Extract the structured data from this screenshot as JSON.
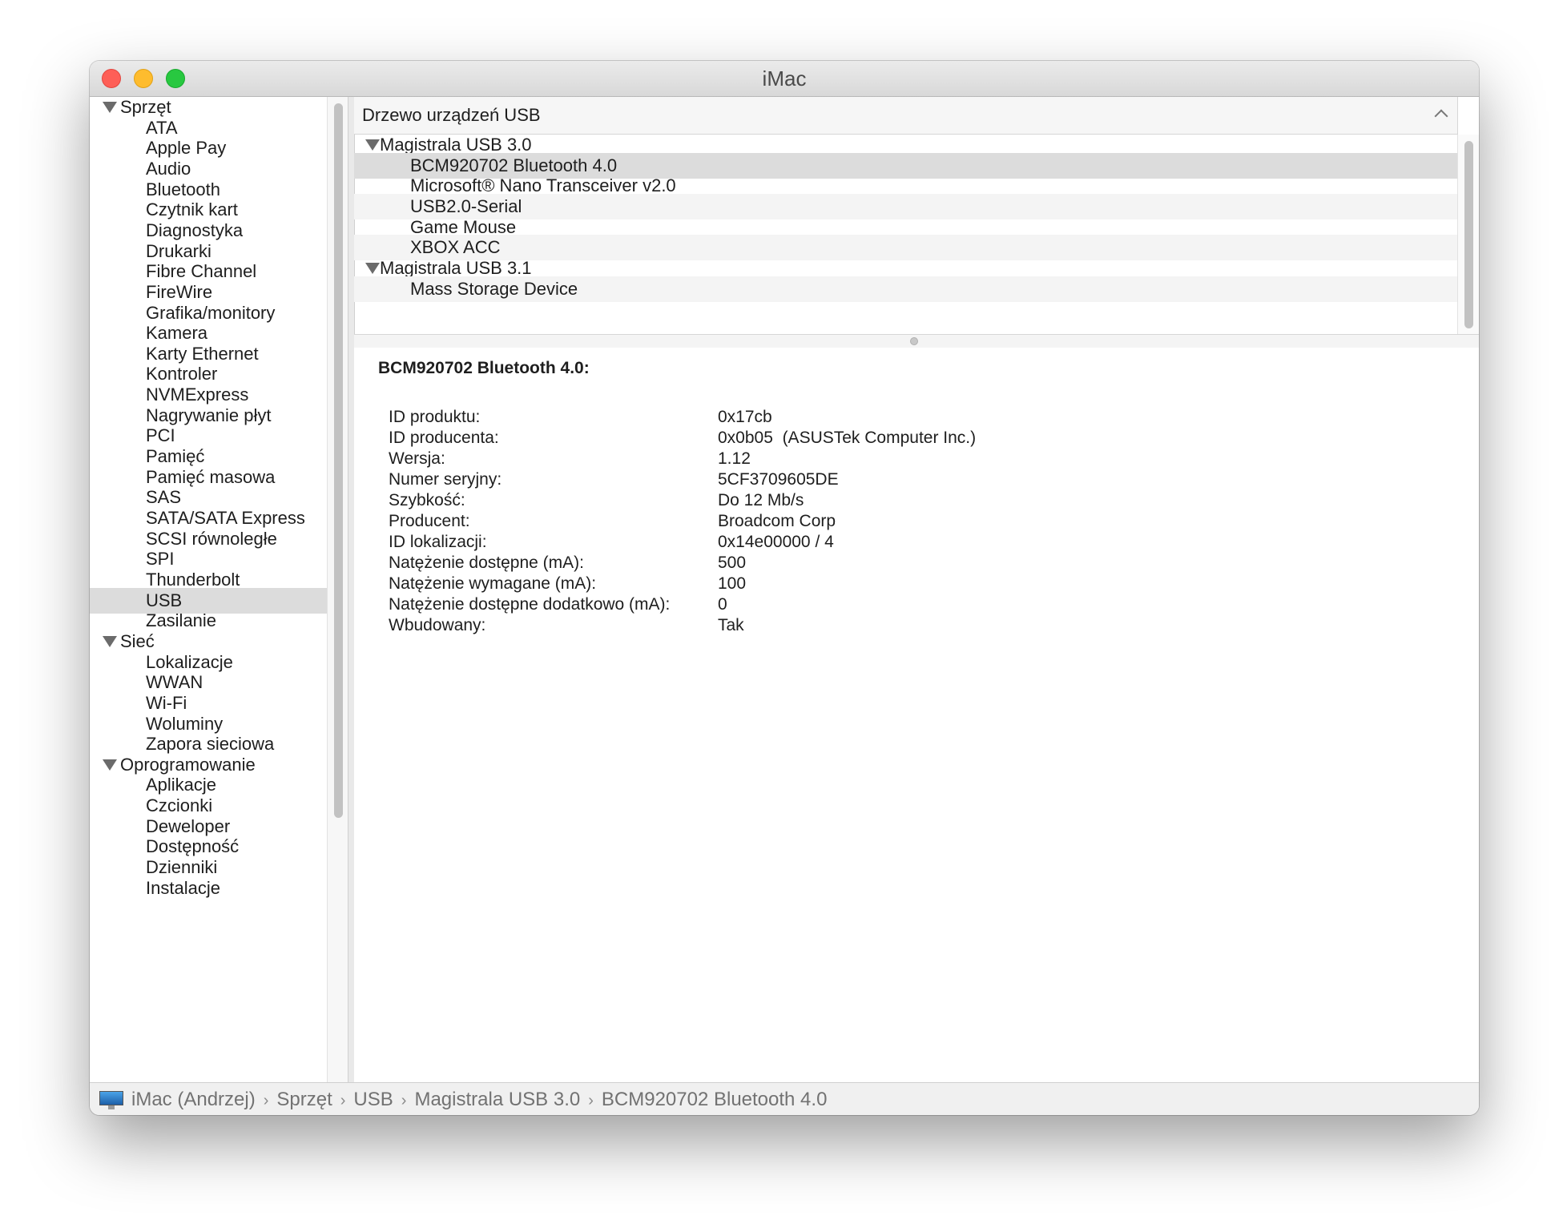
{
  "window": {
    "title": "iMac"
  },
  "sidebar": {
    "items": [
      {
        "label": "Sprzęt",
        "type": "group"
      },
      {
        "label": "ATA",
        "type": "child"
      },
      {
        "label": "Apple Pay",
        "type": "child"
      },
      {
        "label": "Audio",
        "type": "child"
      },
      {
        "label": "Bluetooth",
        "type": "child"
      },
      {
        "label": "Czytnik kart",
        "type": "child"
      },
      {
        "label": "Diagnostyka",
        "type": "child"
      },
      {
        "label": "Drukarki",
        "type": "child"
      },
      {
        "label": "Fibre Channel",
        "type": "child"
      },
      {
        "label": "FireWire",
        "type": "child"
      },
      {
        "label": "Grafika/monitory",
        "type": "child"
      },
      {
        "label": "Kamera",
        "type": "child"
      },
      {
        "label": "Karty Ethernet",
        "type": "child"
      },
      {
        "label": "Kontroler",
        "type": "child"
      },
      {
        "label": "NVMExpress",
        "type": "child"
      },
      {
        "label": "Nagrywanie płyt",
        "type": "child"
      },
      {
        "label": "PCI",
        "type": "child"
      },
      {
        "label": "Pamięć",
        "type": "child"
      },
      {
        "label": "Pamięć masowa",
        "type": "child"
      },
      {
        "label": "SAS",
        "type": "child"
      },
      {
        "label": "SATA/SATA Express",
        "type": "child"
      },
      {
        "label": "SCSI równoległe",
        "type": "child"
      },
      {
        "label": "SPI",
        "type": "child"
      },
      {
        "label": "Thunderbolt",
        "type": "child"
      },
      {
        "label": "USB",
        "type": "child",
        "selected": true
      },
      {
        "label": "Zasilanie",
        "type": "child"
      },
      {
        "label": "Sieć",
        "type": "group"
      },
      {
        "label": "Lokalizacje",
        "type": "child"
      },
      {
        "label": "WWAN",
        "type": "child"
      },
      {
        "label": "Wi-Fi",
        "type": "child"
      },
      {
        "label": "Woluminy",
        "type": "child"
      },
      {
        "label": "Zapora sieciowa",
        "type": "child"
      },
      {
        "label": "Oprogramowanie",
        "type": "group"
      },
      {
        "label": "Aplikacje",
        "type": "child"
      },
      {
        "label": "Czcionki",
        "type": "child"
      },
      {
        "label": "Deweloper",
        "type": "child"
      },
      {
        "label": "Dostępność",
        "type": "child"
      },
      {
        "label": "Dzienniki",
        "type": "child"
      },
      {
        "label": "Instalacje",
        "type": "child"
      }
    ]
  },
  "usb_tree": {
    "header": "Drzewo urządzeń USB",
    "rows": [
      {
        "label": "Magistrala USB 3.0",
        "type": "group"
      },
      {
        "label": "BCM920702 Bluetooth 4.0",
        "type": "child",
        "selected": true
      },
      {
        "label": "Microsoft® Nano Transceiver v2.0",
        "type": "child"
      },
      {
        "label": "USB2.0-Serial",
        "type": "child"
      },
      {
        "label": "Game Mouse",
        "type": "child"
      },
      {
        "label": "XBOX ACC",
        "type": "child"
      },
      {
        "label": "Magistrala USB 3.1",
        "type": "group"
      },
      {
        "label": "Mass Storage Device",
        "type": "child"
      }
    ]
  },
  "details": {
    "title": "BCM920702 Bluetooth 4.0:",
    "rows": [
      {
        "key": "ID produktu:",
        "value": "0x17cb"
      },
      {
        "key": "ID producenta:",
        "value": "0x0b05  (ASUSTek Computer Inc.)"
      },
      {
        "key": "Wersja:",
        "value": "1.12"
      },
      {
        "key": "Numer seryjny:",
        "value": "5CF3709605DE"
      },
      {
        "key": "Szybkość:",
        "value": "Do 12 Mb/s"
      },
      {
        "key": "Producent:",
        "value": "Broadcom Corp"
      },
      {
        "key": "ID lokalizacji:",
        "value": "0x14e00000 / 4"
      },
      {
        "key": "Natężenie dostępne (mA):",
        "value": "500"
      },
      {
        "key": "Natężenie wymagane (mA):",
        "value": "100"
      },
      {
        "key": "Natężenie dostępne dodatkowo (mA):",
        "value": "0"
      },
      {
        "key": "Wbudowany:",
        "value": "Tak"
      }
    ]
  },
  "statusbar": {
    "icon": "computer-icon",
    "breadcrumbs": [
      "iMac (Andrzej)",
      "Sprzęt",
      "USB",
      "Magistrala USB 3.0",
      "BCM920702 Bluetooth 4.0"
    ]
  },
  "colors": {
    "close": "#fe5f57",
    "minimize": "#febc2e",
    "maximize": "#28c840",
    "selection": "#dcdcdc"
  }
}
